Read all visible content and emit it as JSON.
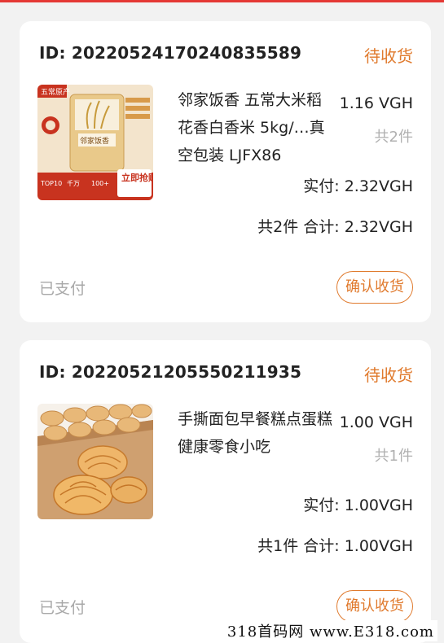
{
  "orders": [
    {
      "id_label": "ID:",
      "id": "2022052417024083558​9",
      "status": "待收货",
      "product_name": "邻家饭香 五常大米稻花香白香米 5kg/…真空包装 LJFX86",
      "price": "1.16 VGH",
      "quantity": "共2件",
      "paid_label": "实付:",
      "paid_value": "2.32VGH",
      "total_text": "共2件 合计:",
      "total_value": "2.32VGH",
      "pay_status": "已支付",
      "confirm_label": "确认收货",
      "thumb": {
        "ribbon": "五常原产",
        "bag_label": "邻家饭香",
        "cta": "立即抢购",
        "badges": [
          "TOP10",
          "千万",
          "100+"
        ]
      }
    },
    {
      "id_label": "ID:",
      "id": "20220521205550211935",
      "status": "待收货",
      "product_name": "手撕面包早餐糕点蛋糕健康零食小吃",
      "price": "1.00 VGH",
      "quantity": "共1件",
      "paid_label": "实付:",
      "paid_value": "1.00VGH",
      "total_text": "共1件 合计:",
      "total_value": "1.00VGH",
      "pay_status": "已支付",
      "confirm_label": "确认收货"
    }
  ],
  "watermark": "318首码网 www.E318.com",
  "colors": {
    "accent": "#e07a2d",
    "top_bar": "#e53935",
    "background": "#f2f2f2"
  }
}
